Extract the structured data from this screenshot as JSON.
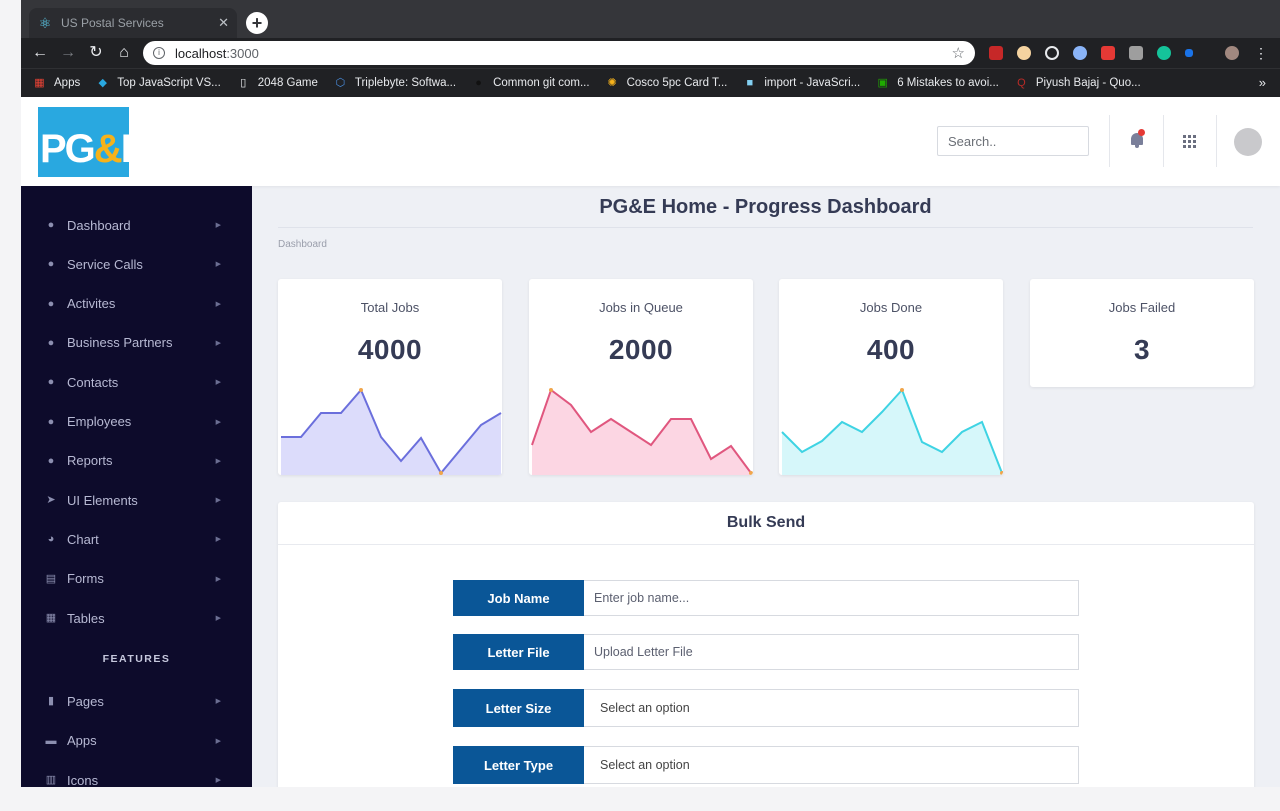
{
  "browser": {
    "tab_title": "US Postal Services",
    "url_host": "localhost",
    "url_port": ":3000",
    "bookmarks": [
      {
        "label": "Apps",
        "icon": "apps-grid-icon",
        "color": "#ea4335"
      },
      {
        "label": "Top JavaScript VS...",
        "icon": "vscode-icon",
        "color": "#29a8e0"
      },
      {
        "label": "2048 Game",
        "icon": "document-icon",
        "color": "#e8eaed"
      },
      {
        "label": "Triplebyte: Softwa...",
        "icon": "triplebyte-icon",
        "color": "#4a90e2"
      },
      {
        "label": "Common git com...",
        "icon": "github-icon",
        "color": "#111111"
      },
      {
        "label": "Cosco 5pc Card T...",
        "icon": "walmart-icon",
        "color": "#f6b21b"
      },
      {
        "label": "import - JavaScri...",
        "icon": "mdn-icon",
        "color": "#83d0f2"
      },
      {
        "label": "6 Mistakes to avoi...",
        "icon": "code-icon",
        "color": "#1faa00"
      },
      {
        "label": "Piyush Bajaj - Quo...",
        "icon": "quora-icon",
        "color": "#b92b27"
      }
    ]
  },
  "header": {
    "logo_text": "PG",
    "logo_amp": "&",
    "logo_text_end": "E",
    "search_placeholder": "Search..",
    "avatar_text": "avatar"
  },
  "sidebar": {
    "items": [
      {
        "label": "Dashboard",
        "icon": "user-circle-icon"
      },
      {
        "label": "Service Calls",
        "icon": "user-circle-icon"
      },
      {
        "label": "Activites",
        "icon": "user-circle-icon"
      },
      {
        "label": "Business Partners",
        "icon": "user-circle-icon"
      },
      {
        "label": "Contacts",
        "icon": "user-circle-icon"
      },
      {
        "label": "Employees",
        "icon": "user-circle-icon"
      },
      {
        "label": "Reports",
        "icon": "user-circle-icon"
      },
      {
        "label": "UI Elements",
        "icon": "rocket-icon"
      },
      {
        "label": "Chart",
        "icon": "pie-chart-icon"
      },
      {
        "label": "Forms",
        "icon": "form-icon"
      },
      {
        "label": "Tables",
        "icon": "table-icon"
      }
    ],
    "section_label": "FEATURES",
    "feature_items": [
      {
        "label": "Pages",
        "icon": "file-icon"
      },
      {
        "label": "Apps",
        "icon": "inbox-icon"
      },
      {
        "label": "Icons",
        "icon": "columns-icon"
      }
    ]
  },
  "main": {
    "title": "PG&E Home - Progress Dashboard",
    "breadcrumb": "Dashboard",
    "cards": [
      {
        "title": "Total Jobs",
        "value": "4000",
        "stroke": "#6b6fdc",
        "fill": "#dcdcfb"
      },
      {
        "title": "Jobs in Queue",
        "value": "2000",
        "stroke": "#e0577f",
        "fill": "#fcd6e3"
      },
      {
        "title": "Jobs Done",
        "value": "400",
        "stroke": "#3ed3e3",
        "fill": "#d6f7fa"
      },
      {
        "title": "Jobs Failed",
        "value": "3"
      }
    ],
    "bulk": {
      "title": "Bulk Send",
      "job_name_label": "Job Name",
      "job_name_placeholder": "Enter job name...",
      "letter_file_label": "Letter File",
      "letter_file_text": "Upload Letter File",
      "letter_size_label": "Letter Size",
      "letter_size_value": "Select an option",
      "letter_type_label": "Letter Type",
      "letter_type_value": "Select an option"
    }
  }
}
